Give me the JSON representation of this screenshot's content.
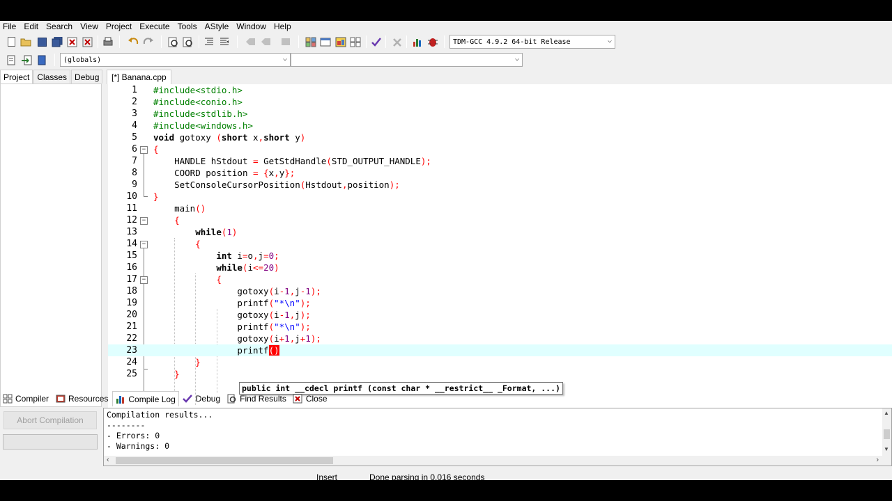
{
  "menu": [
    "File",
    "Edit",
    "Search",
    "View",
    "Project",
    "Execute",
    "Tools",
    "AStyle",
    "Window",
    "Help"
  ],
  "toolbar": {
    "compiler_select": "TDM-GCC 4.9.2 64-bit Release",
    "scope_select": "(globals)",
    "member_select": ""
  },
  "left_panel": {
    "tabs": [
      "Project",
      "Classes",
      "Debug"
    ]
  },
  "editor": {
    "tab_label": "[*] Banana.cpp",
    "current_line": 23,
    "tooltip": "public int __cdecl printf (const char * __restrict__ _Format, ...)"
  },
  "code_lines": [
    "#include<stdio.h>",
    "#include<conio.h>",
    "#include<stdlib.h>",
    "#include<windows.h>",
    "void gotoxy (short x,short y)",
    "{",
    "    HANDLE hStdout = GetStdHandle(STD_OUTPUT_HANDLE);",
    "    COORD position = {x,y};",
    "    SetConsoleCursorPosition(Hstdout,position);",
    "}",
    "    main()",
    "    {",
    "        while(1)",
    "        {",
    "            int i=o,j=0;",
    "            while(i<=20)",
    "            {",
    "                gotoxy(i-1,j-1);",
    "                printf(\"*\\n\");",
    "                gotoxy(i-1,j);",
    "                printf(\"*\\n\");",
    "                gotoxy(i+1,j+1);",
    "                printf()",
    "        }",
    "    }"
  ],
  "bottom_tabs": [
    "Compiler",
    "Resources",
    "Compile Log",
    "Debug",
    "Find Results",
    "Close"
  ],
  "bottom_active": "Compile Log",
  "abort_label": "Abort Compilation",
  "log": [
    "Compilation results...",
    "--------",
    "- Errors: 0",
    "- Warnings: 0"
  ],
  "status": {
    "mode": "Insert",
    "message": "Done parsing in 0.016 seconds"
  },
  "colors": {
    "preprocessor": "#008000",
    "keyword": "#000000",
    "symbol": "#ff0000",
    "number": "#800080",
    "string": "#0000ff",
    "current_line": "#e0ffff"
  }
}
